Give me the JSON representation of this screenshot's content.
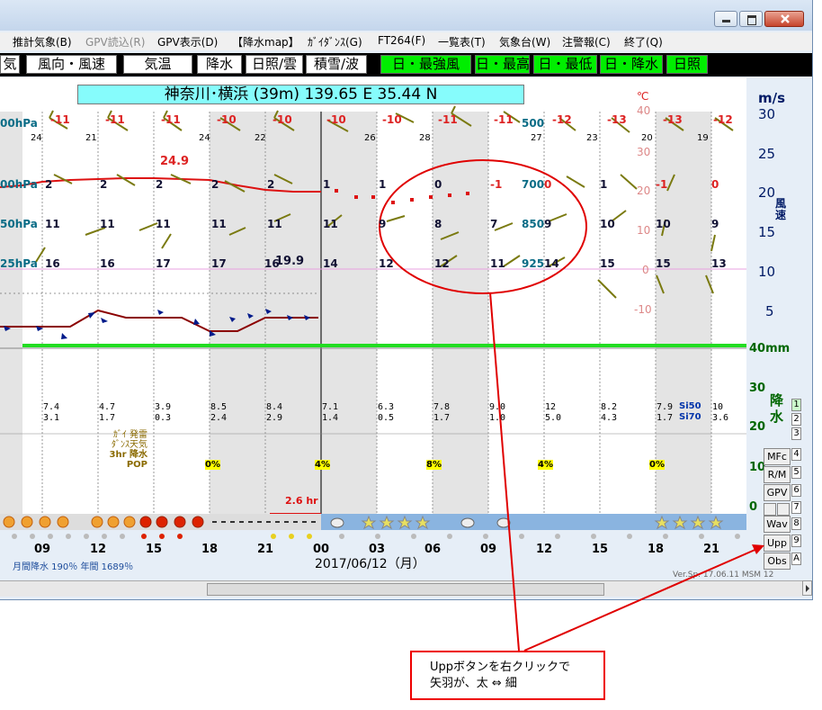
{
  "menu": [
    "推計気象(B)",
    "GPV読込(R)",
    "GPV表示(D)",
    "【降水map】",
    "ｶﾞｲﾀﾞﾝｽ(G)",
    "FT264(F)",
    "一覧表(T)",
    "気象台(W)",
    "注警報(C)",
    "終了(Q)"
  ],
  "tabs": [
    "気",
    "風向・風速",
    "気温",
    "降水",
    "日照/雲",
    "積雪/波",
    "日・最強風",
    "日・最高",
    "日・最低",
    "日・降水",
    "日照"
  ],
  "station": "神奈川･横浜 (39m)  139.65 E   35.44 N",
  "levels": [
    "00hPa",
    "00hPa",
    "50hPa",
    "25hPa"
  ],
  "level_labels": [
    "500",
    "700",
    "850",
    "925"
  ],
  "right_scale": {
    "unit_top": "m/s",
    "unit_temp": "℃",
    "wind_label": "風速",
    "rain_label": "降水",
    "rain_unit": "40mm",
    "wind": [
      "30",
      "25",
      "20",
      "15",
      "10",
      "5"
    ],
    "temp": [
      "40",
      "30",
      "20",
      "10",
      "0",
      "-10"
    ],
    "rain": [
      "30",
      "20",
      "10",
      "0"
    ]
  },
  "row1": [
    "-11",
    "-11",
    "-11",
    "-10",
    "-10",
    "-10",
    "-10",
    "-11",
    "-11",
    "-12",
    "-13",
    "-13",
    "-12"
  ],
  "row1_sub": [
    "24",
    "21",
    "",
    "24",
    "22",
    "",
    "26",
    "28",
    "",
    "27",
    "23",
    "20",
    "19"
  ],
  "row2": [
    "2",
    "2",
    "2",
    "2",
    "2",
    "1",
    "1",
    "0",
    "-1",
    "0",
    "1",
    "-1",
    "0"
  ],
  "row3": [
    "11",
    "11",
    "11",
    "11",
    "11",
    "11",
    "9",
    "8",
    "7",
    "9",
    "10",
    "10",
    "9"
  ],
  "row4": [
    "16",
    "16",
    "17",
    "17",
    "16",
    "14",
    "12",
    "12",
    "11",
    "14",
    "15",
    "15",
    "13"
  ],
  "max_temp": "24.9",
  "max_temp2": "19.9",
  "rain_top": [
    "7.4",
    "4.7",
    "3.9",
    "8.5",
    "8.4",
    "7.1",
    "6.3",
    "7.8",
    "9.0",
    "12",
    "8.2",
    "7.9",
    "10"
  ],
  "rain_bottom": [
    "3.1",
    "1.7",
    "0.3",
    "2.4",
    "2.9",
    "1.4",
    "0.5",
    "1.7",
    "1.0",
    "5.0",
    "4.3",
    "1.7",
    "3.6"
  ],
  "si": [
    "Si50",
    "Si70"
  ],
  "pop": [
    "0%",
    "0%",
    "0%",
    "4%",
    "8%",
    "4%",
    "0%"
  ],
  "legend_lines": [
    "ｶﾞｲ 発雷",
    "ﾀﾞﾝｽ天気",
    "3hr 降水",
    "POP"
  ],
  "rain_hr": "2.6 hr",
  "hours": [
    "09",
    "12",
    "15",
    "18",
    "21",
    "00",
    "03",
    "06",
    "09",
    "12",
    "15",
    "18",
    "21"
  ],
  "date": "2017/06/12（月）",
  "monthly": "月間降水 190％  年間 1689％",
  "version": "Ver.Sp. 17.06.11   MSM 12",
  "side_buttons": [
    "MFc",
    "R/M",
    "GPV",
    "Wav",
    "Upp",
    "Obs"
  ],
  "side_numbers": [
    "1",
    "2",
    "3",
    "4",
    "5",
    "6",
    "7",
    "8",
    "9",
    "A"
  ],
  "callout": [
    "Uppボタンを右クリックで",
    "矢羽が、太 ⇔ 細"
  ],
  "colors": {
    "accent_green": "#00ee00",
    "station_bg": "#86fcfc",
    "callout": "#e00000"
  }
}
